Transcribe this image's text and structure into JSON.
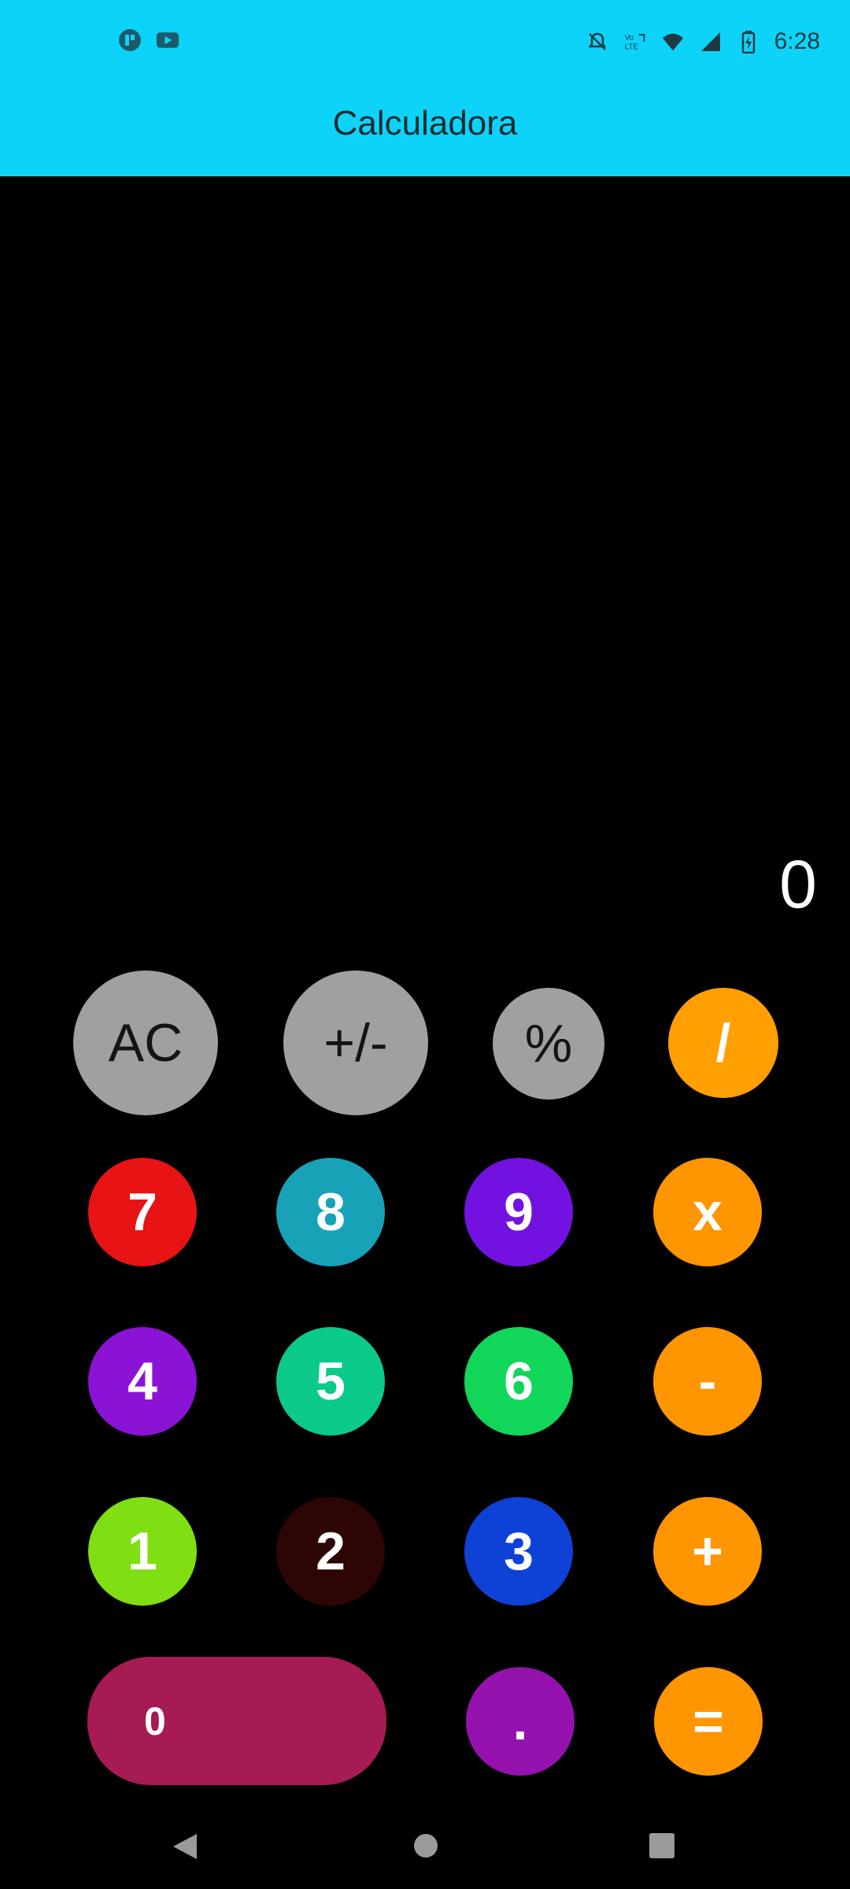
{
  "status_bar": {
    "left_icons": [
      "app-notification-icon",
      "youtube-icon"
    ],
    "right_icons": [
      "notifications-off-icon",
      "volte-lte-icon",
      "wifi-icon",
      "signal-icon",
      "battery-charging-icon"
    ],
    "time": "6:28"
  },
  "app": {
    "title": "Calculadora",
    "bar_color": "#0DD3F9"
  },
  "display": {
    "value": "0"
  },
  "keys": {
    "ac": {
      "label": "AC",
      "color": "#A0A0A0"
    },
    "sign": {
      "label": "+/-",
      "color": "#A0A0A0"
    },
    "percent": {
      "label": "%",
      "color": "#A0A0A0"
    },
    "divide": {
      "label": "/",
      "color": "#FF9F00"
    },
    "seven": {
      "label": "7",
      "color": "#E81314"
    },
    "eight": {
      "label": "8",
      "color": "#17A2B8"
    },
    "nine": {
      "label": "9",
      "color": "#7312E0"
    },
    "multiply": {
      "label": "x",
      "color": "#FF9500"
    },
    "four": {
      "label": "4",
      "color": "#8B13D6"
    },
    "five": {
      "label": "5",
      "color": "#0CC98C"
    },
    "six": {
      "label": "6",
      "color": "#12D65A"
    },
    "minus": {
      "label": "-",
      "color": "#FF9500"
    },
    "one": {
      "label": "1",
      "color": "#80DF12"
    },
    "two": {
      "label": "2",
      "color": "#2D0505"
    },
    "three": {
      "label": "3",
      "color": "#0E42D6"
    },
    "plus": {
      "label": "+",
      "color": "#FF9500"
    },
    "zero": {
      "label": "0",
      "color": "#A61B53"
    },
    "decimal": {
      "label": ".",
      "color": "#9612AE"
    },
    "equals": {
      "label": "=",
      "color": "#FF9500"
    }
  },
  "nav_bar": {
    "icons": [
      "back-icon",
      "home-icon",
      "recents-icon"
    ]
  }
}
